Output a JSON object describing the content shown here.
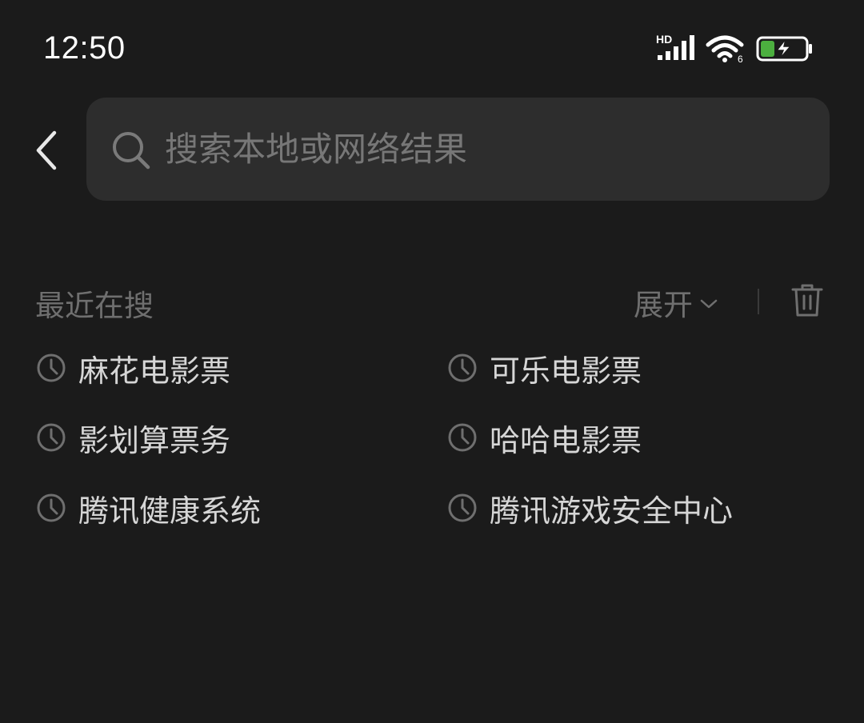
{
  "status_bar": {
    "time": "12:50",
    "network_label": "HD",
    "wifi_badge": "6",
    "battery_color": "#4caf3f"
  },
  "search": {
    "placeholder": "搜索本地或网络结果",
    "value": ""
  },
  "recent": {
    "title": "最近在搜",
    "expand_label": "展开"
  },
  "history": [
    {
      "label": "麻花电影票"
    },
    {
      "label": "可乐电影票"
    },
    {
      "label": "影划算票务"
    },
    {
      "label": "哈哈电影票"
    },
    {
      "label": "腾讯健康系统"
    },
    {
      "label": "腾讯游戏安全中心"
    }
  ],
  "icons": {
    "back": "chevron-left-icon",
    "search": "search-icon",
    "expand": "chevron-down-icon",
    "clear": "trash-icon",
    "history": "clock-icon"
  }
}
